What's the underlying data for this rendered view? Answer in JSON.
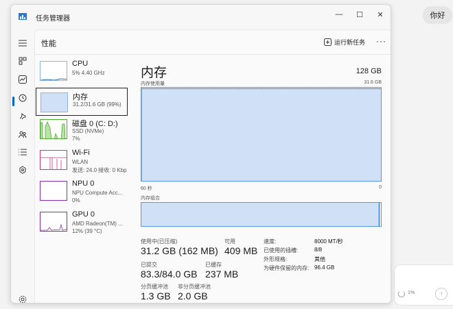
{
  "background": {
    "chat_bubble": "你好",
    "progress_pct": "1%"
  },
  "window": {
    "title": "任务管理器",
    "controls": {
      "minimize": "—",
      "maximize": "☐",
      "close": "✕"
    }
  },
  "header": {
    "page_title": "性能",
    "run_task": "运行新任务",
    "more": "···"
  },
  "nav_icons": [
    "menu-icon",
    "processes-icon",
    "performance-icon",
    "history-icon",
    "startup-icon",
    "users-icon",
    "details-icon",
    "services-icon",
    "settings-icon"
  ],
  "devices": [
    {
      "name": "CPU",
      "line1": "5% 4.40 GHz",
      "line2": "",
      "color": "#1a73c9"
    },
    {
      "name": "内存",
      "line1": "31.2/31.6 GB (99%)",
      "line2": "",
      "color": "#1a73c9"
    },
    {
      "name": "磁盘 0 (C: D:)",
      "line1": "SSD (NVMe)",
      "line2": "7%",
      "color": "#4ea72e"
    },
    {
      "name": "Wi-Fi",
      "line1": "WLAN",
      "line2": "发送: 24.0 接收: 0 Kbp",
      "color": "#c13884"
    },
    {
      "name": "NPU 0",
      "line1": "NPU Compute Acc...",
      "line2": "0%",
      "color": "#8a2ea7"
    },
    {
      "name": "GPU 0",
      "line1": "AMD Radeon(TM) ...",
      "line2": "12% (39 °C)",
      "color": "#8a2ea7"
    }
  ],
  "detail": {
    "title": "内存",
    "total": "128 GB",
    "usage_label": "内存使用量",
    "usage_max": "31.6 GB",
    "usage_fraction": 0.99,
    "axis_left": "60 秒",
    "axis_right": "0",
    "composition_label": "内存组合",
    "stats": {
      "in_use_label": "使用中(已压缩)",
      "in_use": "31.2 GB (162 MB)",
      "available_label": "可用",
      "available": "409 MB",
      "committed_label": "已提交",
      "committed": "83.3/84.0 GB",
      "cached_label": "已缓存",
      "cached": "237 MB",
      "paged_label": "分页缓冲池",
      "paged": "1.3 GB",
      "nonpaged_label": "非分页缓冲池",
      "nonpaged": "2.0 GB"
    },
    "info": [
      {
        "k": "速度:",
        "v": "8000 MT/秒"
      },
      {
        "k": "已使用的插槽:",
        "v": "8/8"
      },
      {
        "k": "外形规格:",
        "v": "其他"
      },
      {
        "k": "为硬件保留的内存:",
        "v": "96.4 GB"
      }
    ]
  }
}
